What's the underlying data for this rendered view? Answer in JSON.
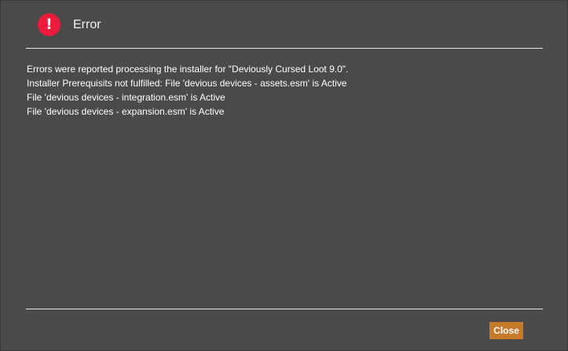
{
  "dialog": {
    "title": "Error",
    "icon": "error-icon",
    "icon_glyph": "!",
    "accent_color": "#ec1b3c",
    "messages": [
      "Errors were reported processing the installer for \"Deviously Cursed Loot 9.0\".",
      "Installer Prerequisits not fulfilled: File 'devious devices - assets.esm' is Active",
      "File 'devious devices - integration.esm' is Active",
      "File 'devious devices - expansion.esm' is Active"
    ],
    "close_label": "Close",
    "close_color": "#c77a2a"
  }
}
